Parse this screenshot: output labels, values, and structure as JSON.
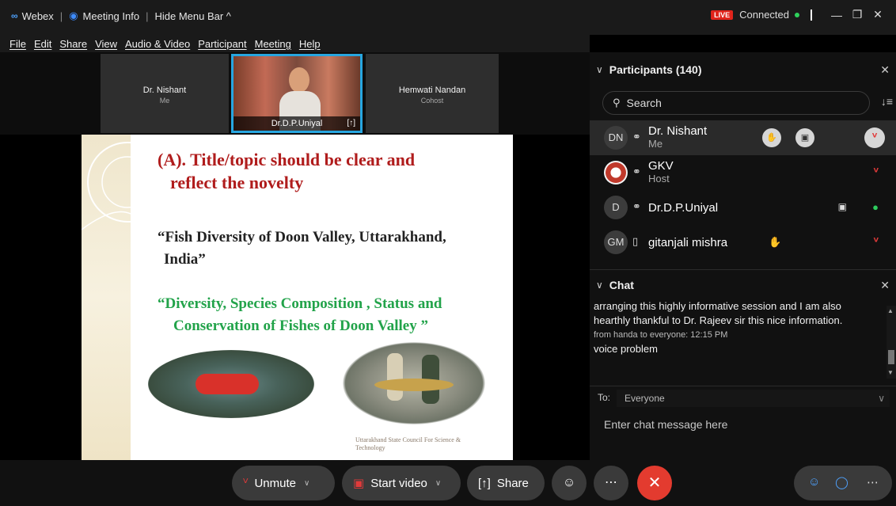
{
  "titlebar": {
    "app_name": "Webex",
    "meeting_info": "Meeting Info",
    "hide_menu": "Hide Menu Bar ^",
    "live": "LIVE",
    "status": "Connected"
  },
  "menu": [
    "File",
    "Edit",
    "Share",
    "View",
    "Audio & Video",
    "Participant",
    "Meeting",
    "Help"
  ],
  "video_strip": [
    {
      "name": "Dr. Nishant",
      "sub": "Me"
    },
    {
      "name": "Dr.D.P.Uniyal",
      "sub": ""
    },
    {
      "name": "Hemwati Nandan",
      "sub": "Cohost"
    }
  ],
  "slide": {
    "title_line1": "(A).  Title/topic should be clear and",
    "title_line2": "reflect the novelty",
    "quote1_line1": "“Fish Diversity of Doon Valley, Uttarakhand,",
    "quote1_line2": "India”",
    "quote2_line1": "“Diversity, Species Composition , Status and",
    "quote2_line2": "Conservation of Fishes of Doon Valley ”",
    "credit": "Uttarakhand State Council For Science & Technology"
  },
  "participants": {
    "header": "Participants (140)",
    "search_placeholder": "Search",
    "list": [
      {
        "initials": "DN",
        "name": "Dr. Nishant",
        "role": "Me"
      },
      {
        "initials": "",
        "name": "GKV",
        "role": "Host"
      },
      {
        "initials": "D",
        "name": "Dr.D.P.Uniyal",
        "role": ""
      },
      {
        "initials": "GM",
        "name": "gitanjali mishra",
        "role": ""
      }
    ]
  },
  "chat": {
    "header": "Chat",
    "line1": "arranging this highly informative session  and I am also",
    "line2": "hearthly thankful to Dr. Rajeev  sir this nice information.",
    "meta": "from handa to everyone:   12:15 PM",
    "line3": "voice problem",
    "to_label": "To:",
    "to_value": "Everyone",
    "input_placeholder": "Enter chat message here"
  },
  "controls": {
    "unmute": "Unmute",
    "start_video": "Start video",
    "share": "Share"
  },
  "colors": {
    "accent": "#27a6e0",
    "live": "#e0241b",
    "end_call": "#e33b2f",
    "slide_title": "#b01c1c",
    "slide_green": "#22a34a"
  }
}
